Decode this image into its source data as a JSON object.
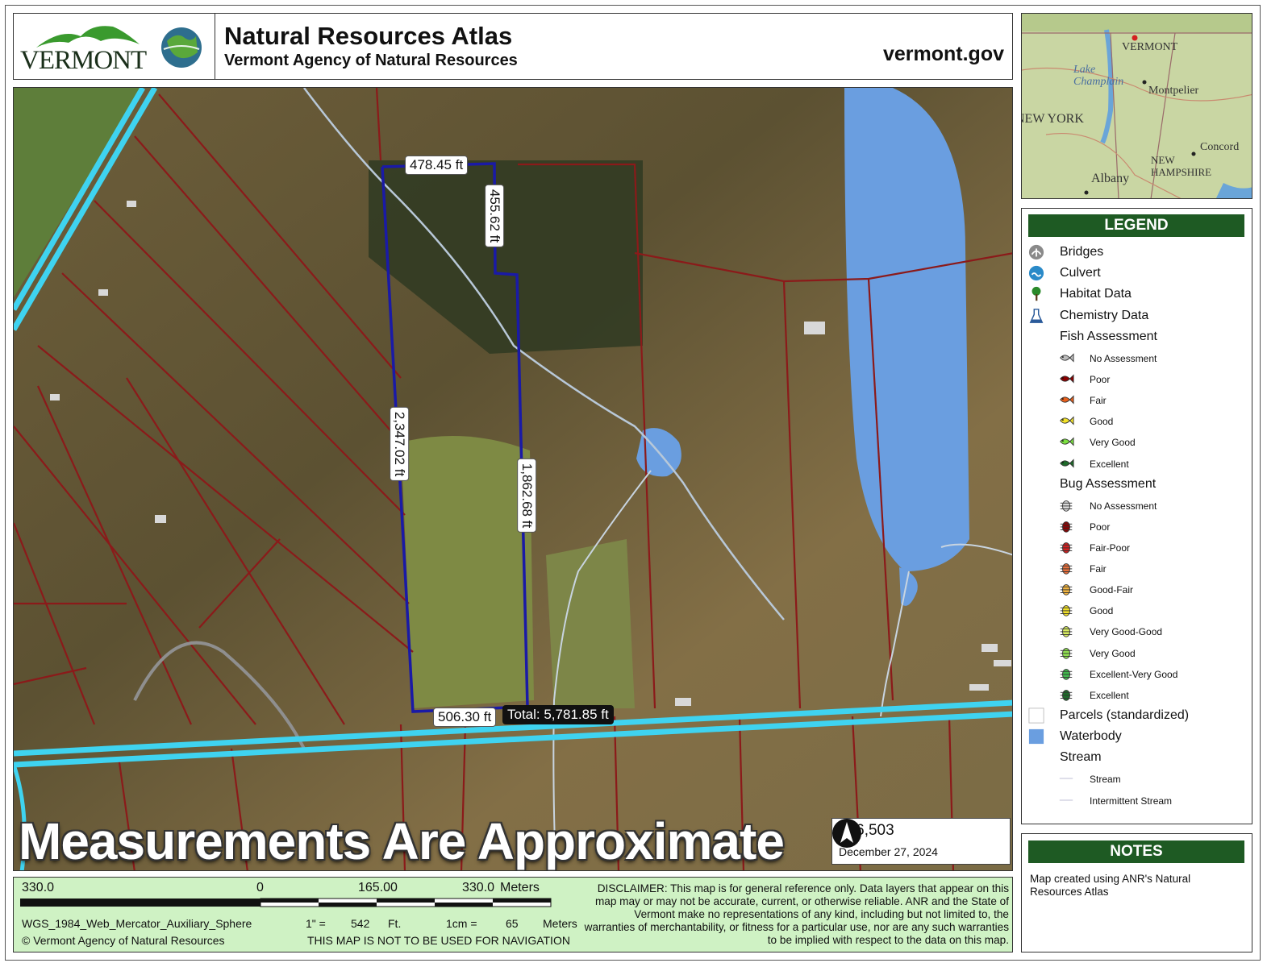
{
  "header": {
    "logo_text": "VERMONT",
    "title": "Natural Resources Atlas",
    "subtitle": "Vermont Agency of Natural Resources",
    "site": "vermont.gov"
  },
  "map": {
    "measurements": {
      "top": "478.45 ft",
      "right_upper": "455.62 ft",
      "left": "2,347.02 ft",
      "right_lower": "1,862.68 ft",
      "bottom": "506.30 ft",
      "total": "Total: 5,781.85 ft"
    },
    "watermark": "Measurements Are Approximate",
    "scale_ratio": "1:  6,503",
    "date": "December 27, 2024",
    "colors": {
      "parcel": "#8b1a1a",
      "road": "#3fd3f0",
      "measure": "#1a1aa6",
      "water": "#6a9ee0"
    }
  },
  "inset": {
    "labels": [
      "VERMONT",
      "Lake Champlain",
      "Montpelier",
      "NEW YORK",
      "Concord",
      "NEW HAMPSHIRE",
      "Albany"
    ]
  },
  "legend": {
    "title": "LEGEND",
    "items": [
      {
        "label": "Bridges",
        "icon": "bridge-icon",
        "level": "main"
      },
      {
        "label": "Culvert",
        "icon": "culvert-icon",
        "level": "main"
      },
      {
        "label": "Habitat Data",
        "icon": "tree-icon",
        "level": "main"
      },
      {
        "label": "Chemistry Data",
        "icon": "flask-icon",
        "level": "main"
      },
      {
        "label": "Fish Assessment",
        "icon": "",
        "level": "main"
      },
      {
        "label": "No Assessment",
        "icon": "fish-icon",
        "level": "sub",
        "color": "#bdbdbd"
      },
      {
        "label": "Poor",
        "icon": "fish-icon",
        "level": "sub",
        "color": "#8b0000"
      },
      {
        "label": "Fair",
        "icon": "fish-icon",
        "level": "sub",
        "color": "#e8601c"
      },
      {
        "label": "Good",
        "icon": "fish-icon",
        "level": "sub",
        "color": "#f2e22a"
      },
      {
        "label": "Very Good",
        "icon": "fish-icon",
        "level": "sub",
        "color": "#7be040"
      },
      {
        "label": "Excellent",
        "icon": "fish-icon",
        "level": "sub",
        "color": "#1e6b2a"
      },
      {
        "label": "Bug Assessment",
        "icon": "",
        "level": "main"
      },
      {
        "label": "No Assessment",
        "icon": "bug-icon",
        "level": "sub",
        "color": "#d8d8d8"
      },
      {
        "label": "Poor",
        "icon": "bug-icon",
        "level": "sub",
        "color": "#8b0000"
      },
      {
        "label": "Fair-Poor",
        "icon": "bug-icon",
        "level": "sub",
        "color": "#d42020"
      },
      {
        "label": "Fair",
        "icon": "bug-icon",
        "level": "sub",
        "color": "#e8703c"
      },
      {
        "label": "Good-Fair",
        "icon": "bug-icon",
        "level": "sub",
        "color": "#f0b440"
      },
      {
        "label": "Good",
        "icon": "bug-icon",
        "level": "sub",
        "color": "#f2e22a"
      },
      {
        "label": "Very Good-Good",
        "icon": "bug-icon",
        "level": "sub",
        "color": "#d8ec60"
      },
      {
        "label": "Very Good",
        "icon": "bug-icon",
        "level": "sub",
        "color": "#90e050"
      },
      {
        "label": "Excellent-Very Good",
        "icon": "bug-icon",
        "level": "sub",
        "color": "#40b84c"
      },
      {
        "label": "Excellent",
        "icon": "bug-icon",
        "level": "sub",
        "color": "#1e6b2a"
      },
      {
        "label": "Parcels (standardized)",
        "icon": "parcel-swatch",
        "level": "main"
      },
      {
        "label": "Waterbody",
        "icon": "water-swatch",
        "level": "main"
      },
      {
        "label": "Stream",
        "icon": "",
        "level": "main"
      },
      {
        "label": "Stream",
        "icon": "stream-line",
        "level": "sub"
      },
      {
        "label": "Intermittent Stream",
        "icon": "stream-line",
        "level": "sub"
      }
    ]
  },
  "notes": {
    "title": "NOTES",
    "text": "Map created using ANR's Natural Resources Atlas"
  },
  "footer": {
    "scale_ticks": [
      "330.0",
      "0",
      "165.00",
      "330.0"
    ],
    "scale_unit": "Meters",
    "projection": "WGS_1984_Web_Mercator_Auxiliary_Sphere",
    "inch_label": "1\" =",
    "inch_value": "542",
    "inch_unit": "Ft.",
    "cm_label": "1cm =",
    "cm_value": "65",
    "cm_unit": "Meters",
    "copyright": "© Vermont Agency of Natural Resources",
    "nav_warning": "THIS MAP IS NOT TO BE USED FOR NAVIGATION",
    "disclaimer": "DISCLAIMER: This map is for general reference only. Data layers that appear on this map may or may not be accurate, current, or otherwise reliable. ANR and the State of Vermont make no representations of any kind, including but not limited to, the warranties of merchantability, or fitness for a particular use, nor are any such warranties to be implied with respect to the data on this map."
  }
}
